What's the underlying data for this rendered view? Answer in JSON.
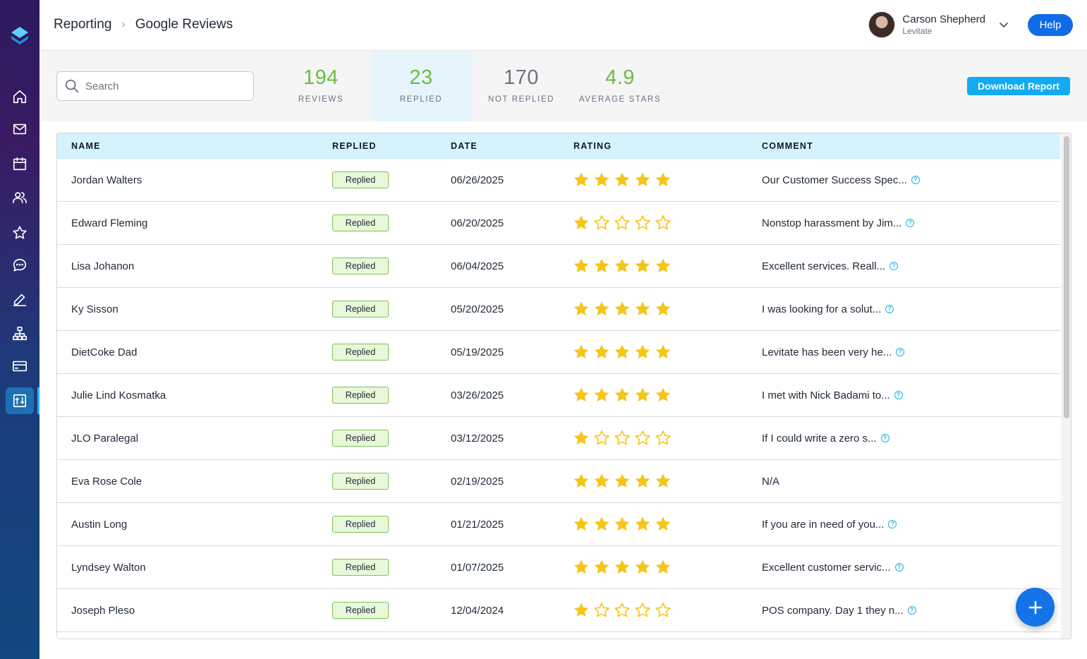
{
  "breadcrumb": {
    "parent": "Reporting",
    "current": "Google Reviews"
  },
  "user": {
    "name": "Carson Shepherd",
    "org": "Levitate"
  },
  "help_label": "Help",
  "search": {
    "placeholder": "Search",
    "value": ""
  },
  "stats": [
    {
      "value": "194",
      "label": "REVIEWS",
      "color": "#6dbb45"
    },
    {
      "value": "23",
      "label": "REPLIED",
      "color": "#6dbb45"
    },
    {
      "value": "170",
      "label": "NOT REPLIED",
      "color": "#6b7280"
    },
    {
      "value": "4.9",
      "label": "AVERAGE STARS",
      "color": "#6dbb45"
    }
  ],
  "download_label": "Download Report",
  "table": {
    "headers": {
      "name": "NAME",
      "replied": "REPLIED",
      "date": "DATE",
      "rating": "RATING",
      "comment": "COMMENT"
    },
    "rows": [
      {
        "name": "Jordan Walters",
        "replied": "Replied",
        "date": "06/26/2025",
        "rating": 5,
        "comment": "Our Customer Success Spec...",
        "has_info": true
      },
      {
        "name": "Edward Fleming",
        "replied": "Replied",
        "date": "06/20/2025",
        "rating": 1,
        "comment": "Nonstop harassment by Jim...",
        "has_info": true
      },
      {
        "name": "Lisa Johanon",
        "replied": "Replied",
        "date": "06/04/2025",
        "rating": 5,
        "comment": "Excellent services. Reall...",
        "has_info": true
      },
      {
        "name": "Ky Sisson",
        "replied": "Replied",
        "date": "05/20/2025",
        "rating": 5,
        "comment": "I was looking for a solut...",
        "has_info": true
      },
      {
        "name": "DietCoke Dad",
        "replied": "Replied",
        "date": "05/19/2025",
        "rating": 5,
        "comment": "Levitate has been very he...",
        "has_info": true
      },
      {
        "name": "Julie Lind Kosmatka",
        "replied": "Replied",
        "date": "03/26/2025",
        "rating": 5,
        "comment": "I met with Nick Badami to...",
        "has_info": true
      },
      {
        "name": "JLO Paralegal",
        "replied": "Replied",
        "date": "03/12/2025",
        "rating": 1,
        "comment": "If I could write a zero s...",
        "has_info": true
      },
      {
        "name": "Eva Rose Cole",
        "replied": "Replied",
        "date": "02/19/2025",
        "rating": 5,
        "comment": "N/A",
        "has_info": false
      },
      {
        "name": "Austin Long",
        "replied": "Replied",
        "date": "01/21/2025",
        "rating": 5,
        "comment": "If you are in need of you...",
        "has_info": true
      },
      {
        "name": "Lyndsey Walton",
        "replied": "Replied",
        "date": "01/07/2025",
        "rating": 5,
        "comment": "Excellent customer servic...",
        "has_info": true
      },
      {
        "name": "Joseph Pleso",
        "replied": "Replied",
        "date": "12/04/2024",
        "rating": 1,
        "comment": "POS company. Day 1 they n...",
        "has_info": true
      }
    ]
  },
  "colors": {
    "star": "#f5c518",
    "accent": "#12aaf0",
    "primary": "#0f6ce6",
    "replied_bg": "#e8f8d8",
    "replied_border": "#7cc257"
  },
  "sidebar": {
    "icons": [
      "home-icon",
      "mail-icon",
      "calendar-icon",
      "contacts-icon",
      "star-icon",
      "chat-icon",
      "edit-icon",
      "hierarchy-icon",
      "card-icon",
      "reporting-icon"
    ],
    "active": "reporting-icon"
  }
}
